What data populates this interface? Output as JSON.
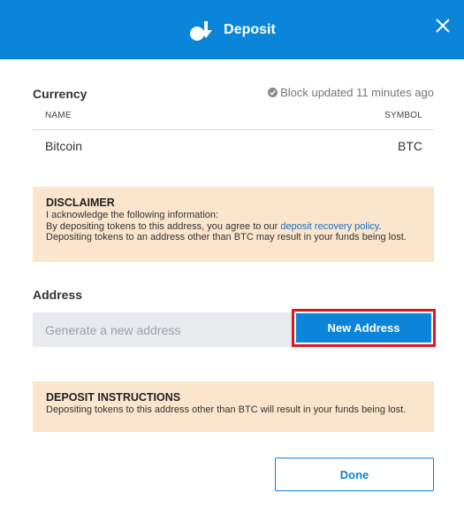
{
  "header": {
    "title": "Deposit",
    "icon": "deposit-icon",
    "close_icon": "close-icon",
    "background": "#0a85d9"
  },
  "currency": {
    "title": "Currency",
    "block_updated": "Block updated 11 minutes ago",
    "columns": {
      "name": "NAME",
      "symbol": "SYMBOL"
    },
    "row": {
      "name": "Bitcoin",
      "symbol": "BTC"
    }
  },
  "disclaimer": {
    "title": "DISCLAIMER",
    "line1": "I acknowledge the following information:",
    "line2_pre": "By depositing tokens to this address, you agree to our ",
    "link": "deposit recovery policy",
    "line2_post": ". Depositing tokens to an address other than BTC may result in your funds being lost."
  },
  "address": {
    "label": "Address",
    "placeholder": "Generate a new address",
    "new_button": "New Address"
  },
  "instructions": {
    "title": "DEPOSIT INSTRUCTIONS",
    "text": "Depositing tokens to this address other than BTC will result in your funds being lost."
  },
  "footer": {
    "done_button": "Done"
  },
  "colors": {
    "accent": "#0a85d9",
    "notice_bg": "#fbe5cc",
    "highlight": "#e0161f"
  }
}
